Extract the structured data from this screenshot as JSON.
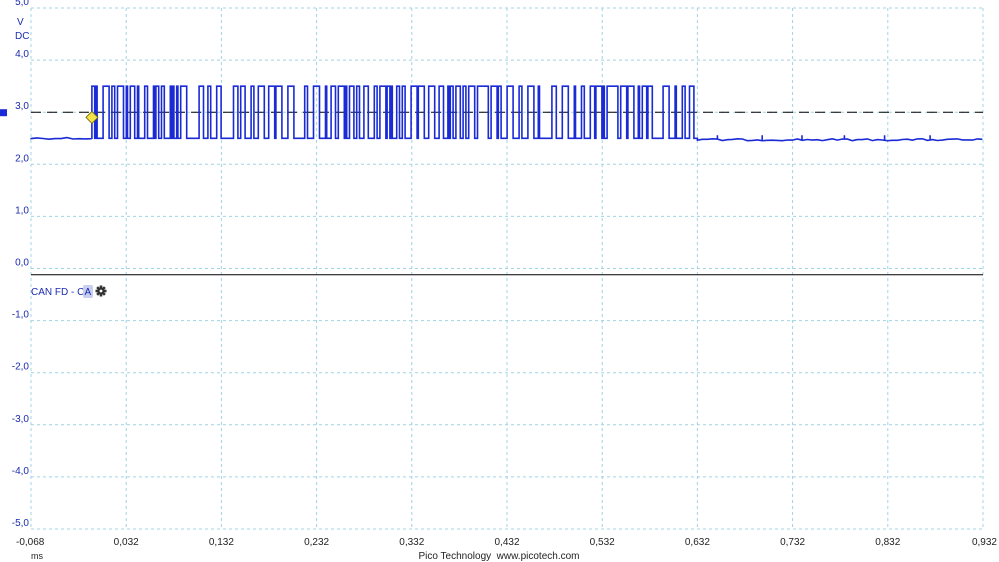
{
  "chart_data": {
    "type": "line",
    "title": "",
    "y_unit": "V",
    "coupling": "DC",
    "x_unit": "ms",
    "ylim": [
      -5.0,
      5.0
    ],
    "xlim": [
      -0.068,
      0.932
    ],
    "y_ticks": [
      "-5,0",
      "-4,0",
      "-3,0",
      "-2,0",
      "-1,0",
      "0,0",
      "1,0",
      "2,0",
      "3,0",
      "4,0",
      "5,0"
    ],
    "y_tick_values": [
      -5,
      -4,
      -3,
      -2,
      -1,
      0,
      1,
      2,
      3,
      4,
      5
    ],
    "x_ticks": [
      "-0,068",
      "0,032",
      "0,132",
      "0,232",
      "0,332",
      "0,432",
      "0,532",
      "0,632",
      "0,732",
      "0,832",
      "0,932"
    ],
    "x_tick_values": [
      -0.068,
      0.032,
      0.132,
      0.232,
      0.332,
      0.432,
      0.532,
      0.632,
      0.732,
      0.832,
      0.932
    ],
    "grid": true,
    "series": [
      {
        "name": "Ch A",
        "color": "#1a2bd6",
        "idle_level": 2.5,
        "dominant_level": 3.5,
        "burst_start": -0.004,
        "burst_end": 0.632
      }
    ],
    "trigger": {
      "x": -0.004,
      "y": 2.9,
      "color": "#f2e34a"
    },
    "threshold_level": 3.0,
    "decoder_label": "CAN FD - Ch",
    "decoder_channel": "A",
    "footer": "Pico Technology  www.picotech.com"
  }
}
